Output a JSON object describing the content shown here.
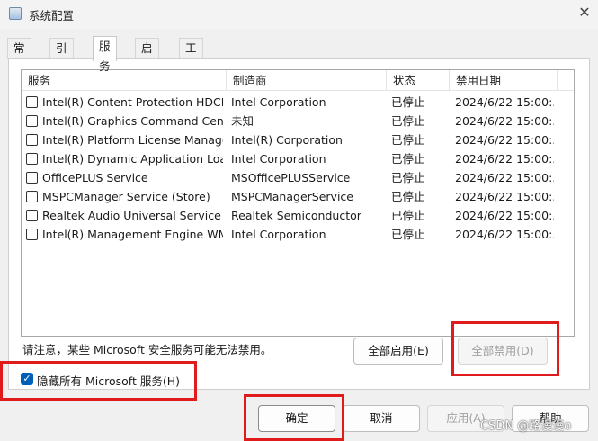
{
  "window": {
    "title": "系统配置",
    "close_glyph": "✕"
  },
  "tabs": [
    "常规",
    "引导",
    "服务",
    "启动",
    "工具"
  ],
  "active_tab": "服务",
  "services_table": {
    "headers": [
      "服务",
      "制造商",
      "状态",
      "禁用日期"
    ],
    "rows": [
      [
        "Intel(R) Content Protection HDCP...",
        "Intel Corporation",
        "已停止",
        "2024/6/22 15:00:..."
      ],
      [
        "Intel(R) Graphics Command Cent...",
        "未知",
        "已停止",
        "2024/6/22 15:00:..."
      ],
      [
        "Intel(R) Platform License Manage...",
        "Intel(R) Corporation",
        "已停止",
        "2024/6/22 15:00:..."
      ],
      [
        "Intel(R) Dynamic Application Loa...",
        "Intel Corporation",
        "已停止",
        "2024/6/22 15:00:..."
      ],
      [
        "OfficePLUS Service",
        "MSOfficePLUSService",
        "已停止",
        "2024/6/22 15:00:..."
      ],
      [
        "MSPCManager Service (Store)",
        "MSPCManagerService",
        "已停止",
        "2024/6/22 15:00:..."
      ],
      [
        "Realtek Audio Universal Service",
        "Realtek Semiconductor",
        "已停止",
        "2024/6/22 15:00:..."
      ],
      [
        "Intel(R) Management Engine WM...",
        "Intel Corporation",
        "已停止",
        "2024/6/22 15:00:..."
      ]
    ],
    "checked": [
      false,
      false,
      false,
      false,
      false,
      false,
      false,
      false
    ]
  },
  "note": "请注意，某些 Microsoft 安全服务可能无法禁用。",
  "buttons": {
    "enable_all": "全部启用(E)",
    "disable_all": "全部禁用(D)",
    "ok": "确定",
    "cancel": "取消",
    "apply": "应用(A)",
    "help": "帮助"
  },
  "hide_microsoft": {
    "label": "隐藏所有 Microsoft 服务(H)",
    "checked": true,
    "check_glyph": "✓"
  },
  "watermark": "CSDN @路漫漫o",
  "colors": {
    "highlight_box": "#e01b1b",
    "checkbox_accent": "#005fb8"
  }
}
